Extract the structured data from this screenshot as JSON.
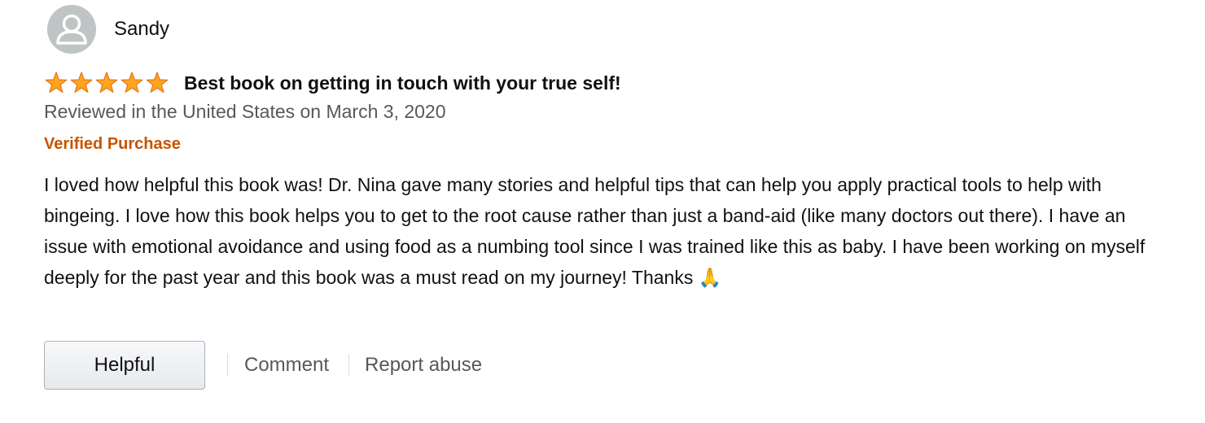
{
  "reviewer": {
    "name": "Sandy",
    "avatar_icon": "user-silhouette-icon"
  },
  "rating": {
    "stars": 5,
    "max": 5,
    "star_color": "#ffa41c"
  },
  "review": {
    "title": "Best book on getting in touch with your true self!",
    "date_line": "Reviewed in the United States on March 3, 2020",
    "badge": "Verified Purchase",
    "badge_color": "#c45500",
    "body": "I loved how helpful this book was! Dr. Nina gave many stories and helpful tips that can help you apply practical tools to help with bingeing. I love how this book helps you to get to the root cause rather than just a band-aid (like many doctors out there). I have an issue with emotional avoidance and using food as a numbing tool since I was trained like this as baby. I have been working on myself deeply for the past year and this book was a must read on my journey! Thanks 🙏"
  },
  "actions": {
    "helpful_label": "Helpful",
    "comment_label": "Comment",
    "report_label": "Report abuse"
  }
}
